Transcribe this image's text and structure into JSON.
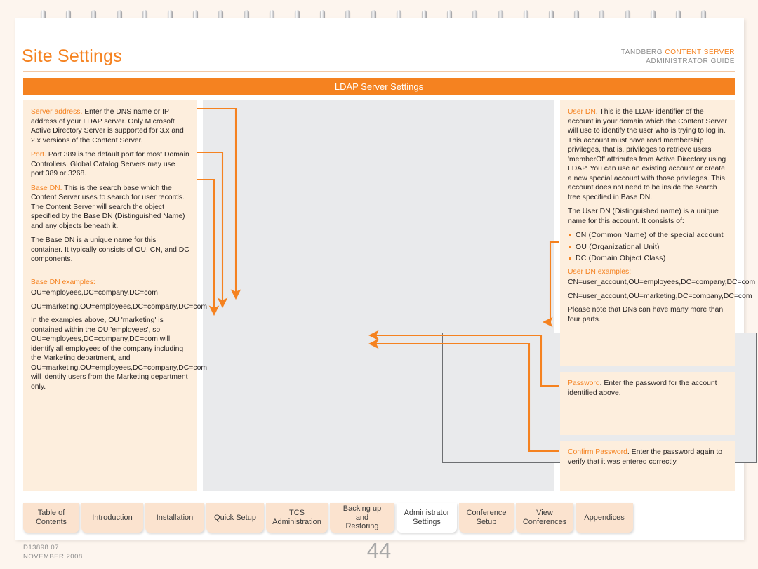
{
  "header": {
    "title": "Site Settings",
    "product_line1_plain": "TANDBERG ",
    "product_line1_highlight": "CONTENT SERVER",
    "product_line2": "ADMINISTRATOR GUIDE"
  },
  "banner": {
    "title": "LDAP Server Settings"
  },
  "colors": {
    "accent": "#f58220",
    "callout_bg": "#fdeedd",
    "panel_bg": "#e9eaec",
    "page_bg": "#fdf5ee",
    "tab_bg": "#fbe3cf",
    "frame_border": "#6d6f72",
    "muted_text": "#8c8c8c"
  },
  "callouts": {
    "left": [
      {
        "term": "Server address.",
        "text": " Enter the DNS name or IP address of your LDAP server. Only Microsoft Active Directory Server is supported for 3.x and 2.x versions of the Content Server."
      },
      {
        "term": "Port.",
        "text": " Port 389 is the default port for most Domain Controllers. Global Catalog Servers may use port 389 or 3268."
      },
      {
        "term": "Base DN.",
        "text": "  This is the search base which the Content Server uses to search for user records. The Content Server will search the object specified by the Base DN (Distinguished Name) and any objects beneath it."
      },
      {
        "term": "",
        "text": "The Base DN is a unique name for this container. It typically consists of OU, CN, and DC components."
      }
    ],
    "left_examples_heading": "Base DN examples:",
    "left_examples": [
      "OU=employees,DC=company,DC=com",
      "OU=marketing,OU=employees,DC=company,DC=com"
    ],
    "left_closing": "In the examples above, OU 'marketing'  is contained within the OU 'employees', so OU=employees,DC=company,DC=com will identify all employees of the company including the Marketing department, and OU=marketing,OU=employees,DC=company,DC=com will identify users from the Marketing department only.",
    "userdn": {
      "term": "User DN",
      "text": ". This is the LDAP identifier of the account in your domain which the Content Server will use to identify the user who is trying to log in. This account must have read membership privileges, that is, privileges to retrieve users' 'memberOf' attributes from Active Directory using LDAP. You can use an existing account or create a new special account with those privileges. This account does not need to be inside the search tree specified in Base DN.",
      "second_para": "The User DN (Distinguished name) is a unique name for this account. It consists of:",
      "bullets": [
        "CN (Common Name) of the special account",
        "OU (Organizational Unit)",
        "DC (Domain Object Class)"
      ],
      "examples_heading": "User DN examples:",
      "examples": [
        "CN=user_account,OU=employees,DC=company,DC=com",
        "CN=user_account,OU=marketing,DC=company,DC=com"
      ],
      "note": "Please note that DNs can have many more than four parts."
    },
    "password": {
      "term": "Password",
      "text": ". Enter the password for the account identified above."
    },
    "confirm_password": {
      "term": "Confirm Password",
      "text": ". Enter the password again to verify that it was entered correctly."
    }
  },
  "tabs": [
    {
      "label": "Table of\nContents",
      "active": false
    },
    {
      "label": "Introduction",
      "active": false
    },
    {
      "label": "Installation",
      "active": false
    },
    {
      "label": "Quick Setup",
      "active": false
    },
    {
      "label": "TCS\nAdministration",
      "active": false
    },
    {
      "label": "Backing up and\nRestoring",
      "active": false
    },
    {
      "label": "Administrator\nSettings",
      "active": true
    },
    {
      "label": "Conference\nSetup",
      "active": false
    },
    {
      "label": "View\nConferences",
      "active": false
    },
    {
      "label": "Appendices",
      "active": false
    }
  ],
  "footer": {
    "doc_id": "D13898.07",
    "doc_date": "NOVEMBER 2008",
    "page_number": "44"
  }
}
